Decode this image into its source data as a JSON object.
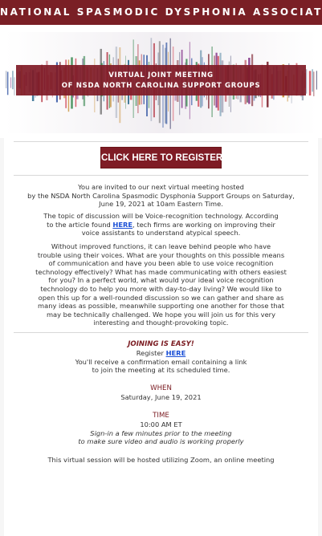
{
  "header": {
    "org_name": "NATIONAL SPASMODIC DYSPHONIA ASSOCIATION",
    "meeting_line1": "VIRTUAL JOINT MEETING",
    "meeting_line2": "OF NSDA NORTH CAROLINA SUPPORT GROUPS"
  },
  "register_button": {
    "label": "CLICK HERE TO REGISTER"
  },
  "intro": {
    "line1": "You are invited to our next virtual meeting hosted",
    "line2": "by the NSDA North Carolina Spasmodic Dysphonia Support Groups on Saturday,",
    "line3": "June 19, 2021 at 10am Eastern Time."
  },
  "topic": {
    "line1": "The topic of discussion will be Voice-recognition technology. According",
    "line2_pre": "to the article found ",
    "line2_link": "HERE",
    "line2_post": ", tech firms are working on improving their",
    "line3": "voice assistants to understand atypical speech."
  },
  "discussion": {
    "lines": [
      "Without improved functions, it can leave behind people who have",
      "trouble using their voices. What are your thoughts on this possible means",
      "of communication and have you been able to use voice recognition",
      "technology effectively? What has made communicating with others easiest",
      "for you? In a perfect world, what would your ideal voice recognition",
      "technology do to help you more with day-to-day living? We would like to",
      "open this up for a well-rounded discussion so we can gather and share as",
      "many ideas as possible, meanwhile supporting one another for those that",
      "may be technically challenged. We hope you will join us for this very",
      "interesting and thought-provoking topic."
    ]
  },
  "joining": {
    "heading": "JOINING IS EASY!",
    "register_pre": "Register ",
    "register_link": "HERE",
    "line2": "You'll receive a confirmation email containing a link",
    "line3": "to join the meeting at its scheduled time."
  },
  "when": {
    "label": "WHEN",
    "value": "Saturday, June 19, 2021"
  },
  "time": {
    "label": "TIME",
    "value": "10:00 AM ET",
    "note1": "Sign-in a few minutes prior to the meeting",
    "note2": "to make sure video and audio is working properly"
  },
  "hosting": {
    "line1": "This virtual session will be hosted utilizing Zoom, an online meeting"
  }
}
